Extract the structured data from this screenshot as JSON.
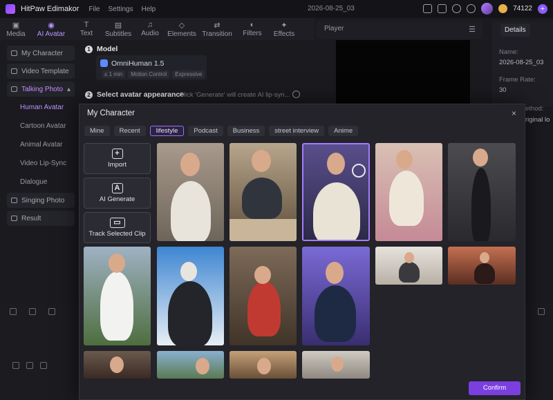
{
  "app": {
    "name": "HitPaw Edimakor",
    "menu": [
      "File",
      "Settings",
      "Help"
    ],
    "doc_title": "2026-08-25_03",
    "credits": "74122",
    "plus": "+"
  },
  "toolbar": [
    {
      "label": "Media",
      "icon": "media-icon"
    },
    {
      "label": "AI Avatar",
      "icon": "ai-avatar-icon",
      "active": true
    },
    {
      "label": "Text",
      "icon": "text-icon"
    },
    {
      "label": "Subtitles",
      "icon": "subtitles-icon"
    },
    {
      "label": "Audio",
      "icon": "audio-icon"
    },
    {
      "label": "Elements",
      "icon": "elements-icon"
    },
    {
      "label": "Transition",
      "icon": "transition-icon"
    },
    {
      "label": "Filters",
      "icon": "filters-icon"
    },
    {
      "label": "Effects",
      "icon": "effects-icon"
    }
  ],
  "player": {
    "title": "Player"
  },
  "details": {
    "tab": "Details",
    "name_label": "Name:",
    "name_value": "2026-08-25_03",
    "fps_label": "Frame Rate:",
    "fps_value": "30",
    "method_partial": "ethod:",
    "original_partial": "riginal lo"
  },
  "sidebar": {
    "items": [
      "My Character",
      "Video Template",
      "Talking Photo",
      "Singing Photo",
      "Result"
    ],
    "sub_items": [
      "Human Avatar",
      "Cartoon Avatar",
      "Animal Avatar",
      "Video Lip-Sync",
      "Dialogue"
    ]
  },
  "panel": {
    "step1": "Model",
    "step1_num": "1",
    "model_name": "OmniHuman 1.5",
    "model_tags": [
      "≤ 1 min",
      "Motion Control",
      "Expressive"
    ],
    "step2": "Select avatar appearance",
    "step2_num": "2",
    "hint": "Click 'Generate' will create AI lip-syn..."
  },
  "modal": {
    "title": "My Character",
    "close": "×",
    "chips": [
      "Mine",
      "Recent",
      "lifestyle",
      "Podcast",
      "Business",
      "street interview",
      "Anime"
    ],
    "active_chip": "lifestyle",
    "actions": [
      {
        "label": "Import",
        "icon": "import-icon",
        "glyph": "+"
      },
      {
        "label": "AI Generate",
        "icon": "ai-generate-icon",
        "glyph": "A"
      },
      {
        "label": "Track Selected Clip",
        "icon": "track-clip-icon",
        "glyph": "▭"
      }
    ],
    "confirm": "Confirm"
  },
  "colors": {
    "accent": "#7b3fe0",
    "selection": "#a57cff",
    "active_text": "#b896ff"
  }
}
